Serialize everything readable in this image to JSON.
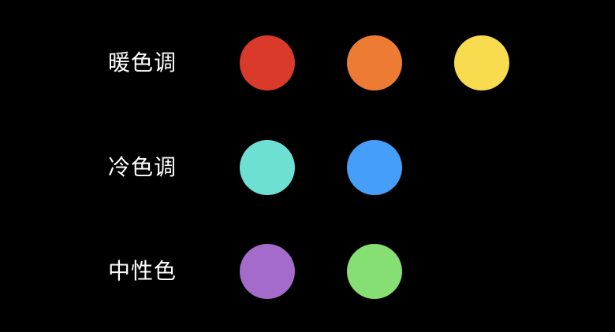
{
  "groups": [
    {
      "label": "暖色调",
      "swatches": [
        {
          "name": "red",
          "color": "#d93a2a"
        },
        {
          "name": "orange",
          "color": "#ed7b33"
        },
        {
          "name": "yellow",
          "color": "#f8db4e"
        }
      ]
    },
    {
      "label": "冷色调",
      "swatches": [
        {
          "name": "cyan",
          "color": "#6de0d3"
        },
        {
          "name": "blue",
          "color": "#459ff9"
        }
      ]
    },
    {
      "label": "中性色",
      "swatches": [
        {
          "name": "purple",
          "color": "#a56bcb"
        },
        {
          "name": "green",
          "color": "#85df72"
        }
      ]
    }
  ]
}
